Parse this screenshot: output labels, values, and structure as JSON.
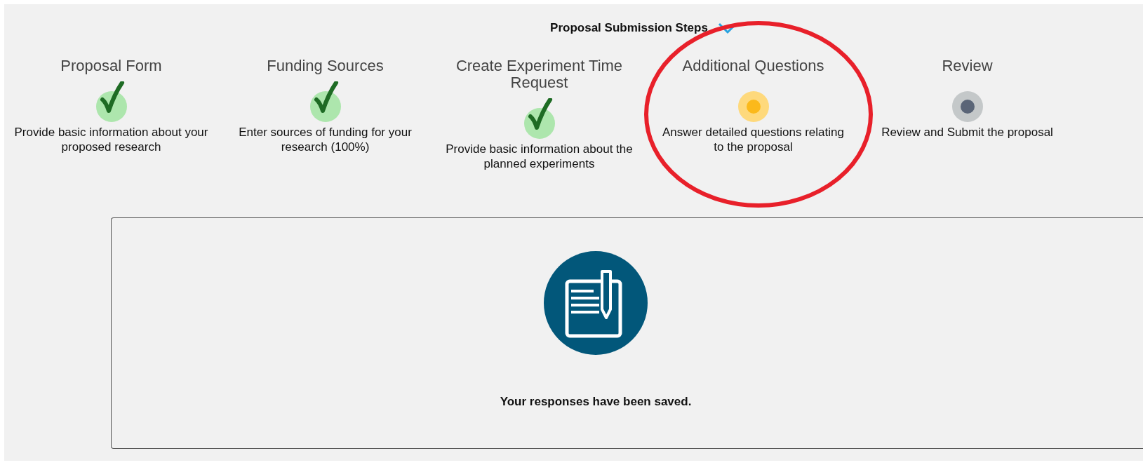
{
  "header": {
    "title": "Proposal Submission Steps",
    "expanded": true
  },
  "steps": [
    {
      "title": "Proposal Form",
      "kind": "done",
      "description": "Provide basic information about your proposed research"
    },
    {
      "title": "Funding Sources",
      "kind": "done",
      "description": "Enter sources of funding for your research (100%)"
    },
    {
      "title": "Create Experiment Time Request",
      "kind": "done",
      "description": "Provide basic information about the planned experiments"
    },
    {
      "title": "Additional Questions",
      "kind": "current",
      "description": "Answer detailed questions relating to the proposal"
    },
    {
      "title": "Review",
      "kind": "pending",
      "description": "Review and Submit the proposal"
    }
  ],
  "panel": {
    "message": "Your responses have been saved."
  }
}
